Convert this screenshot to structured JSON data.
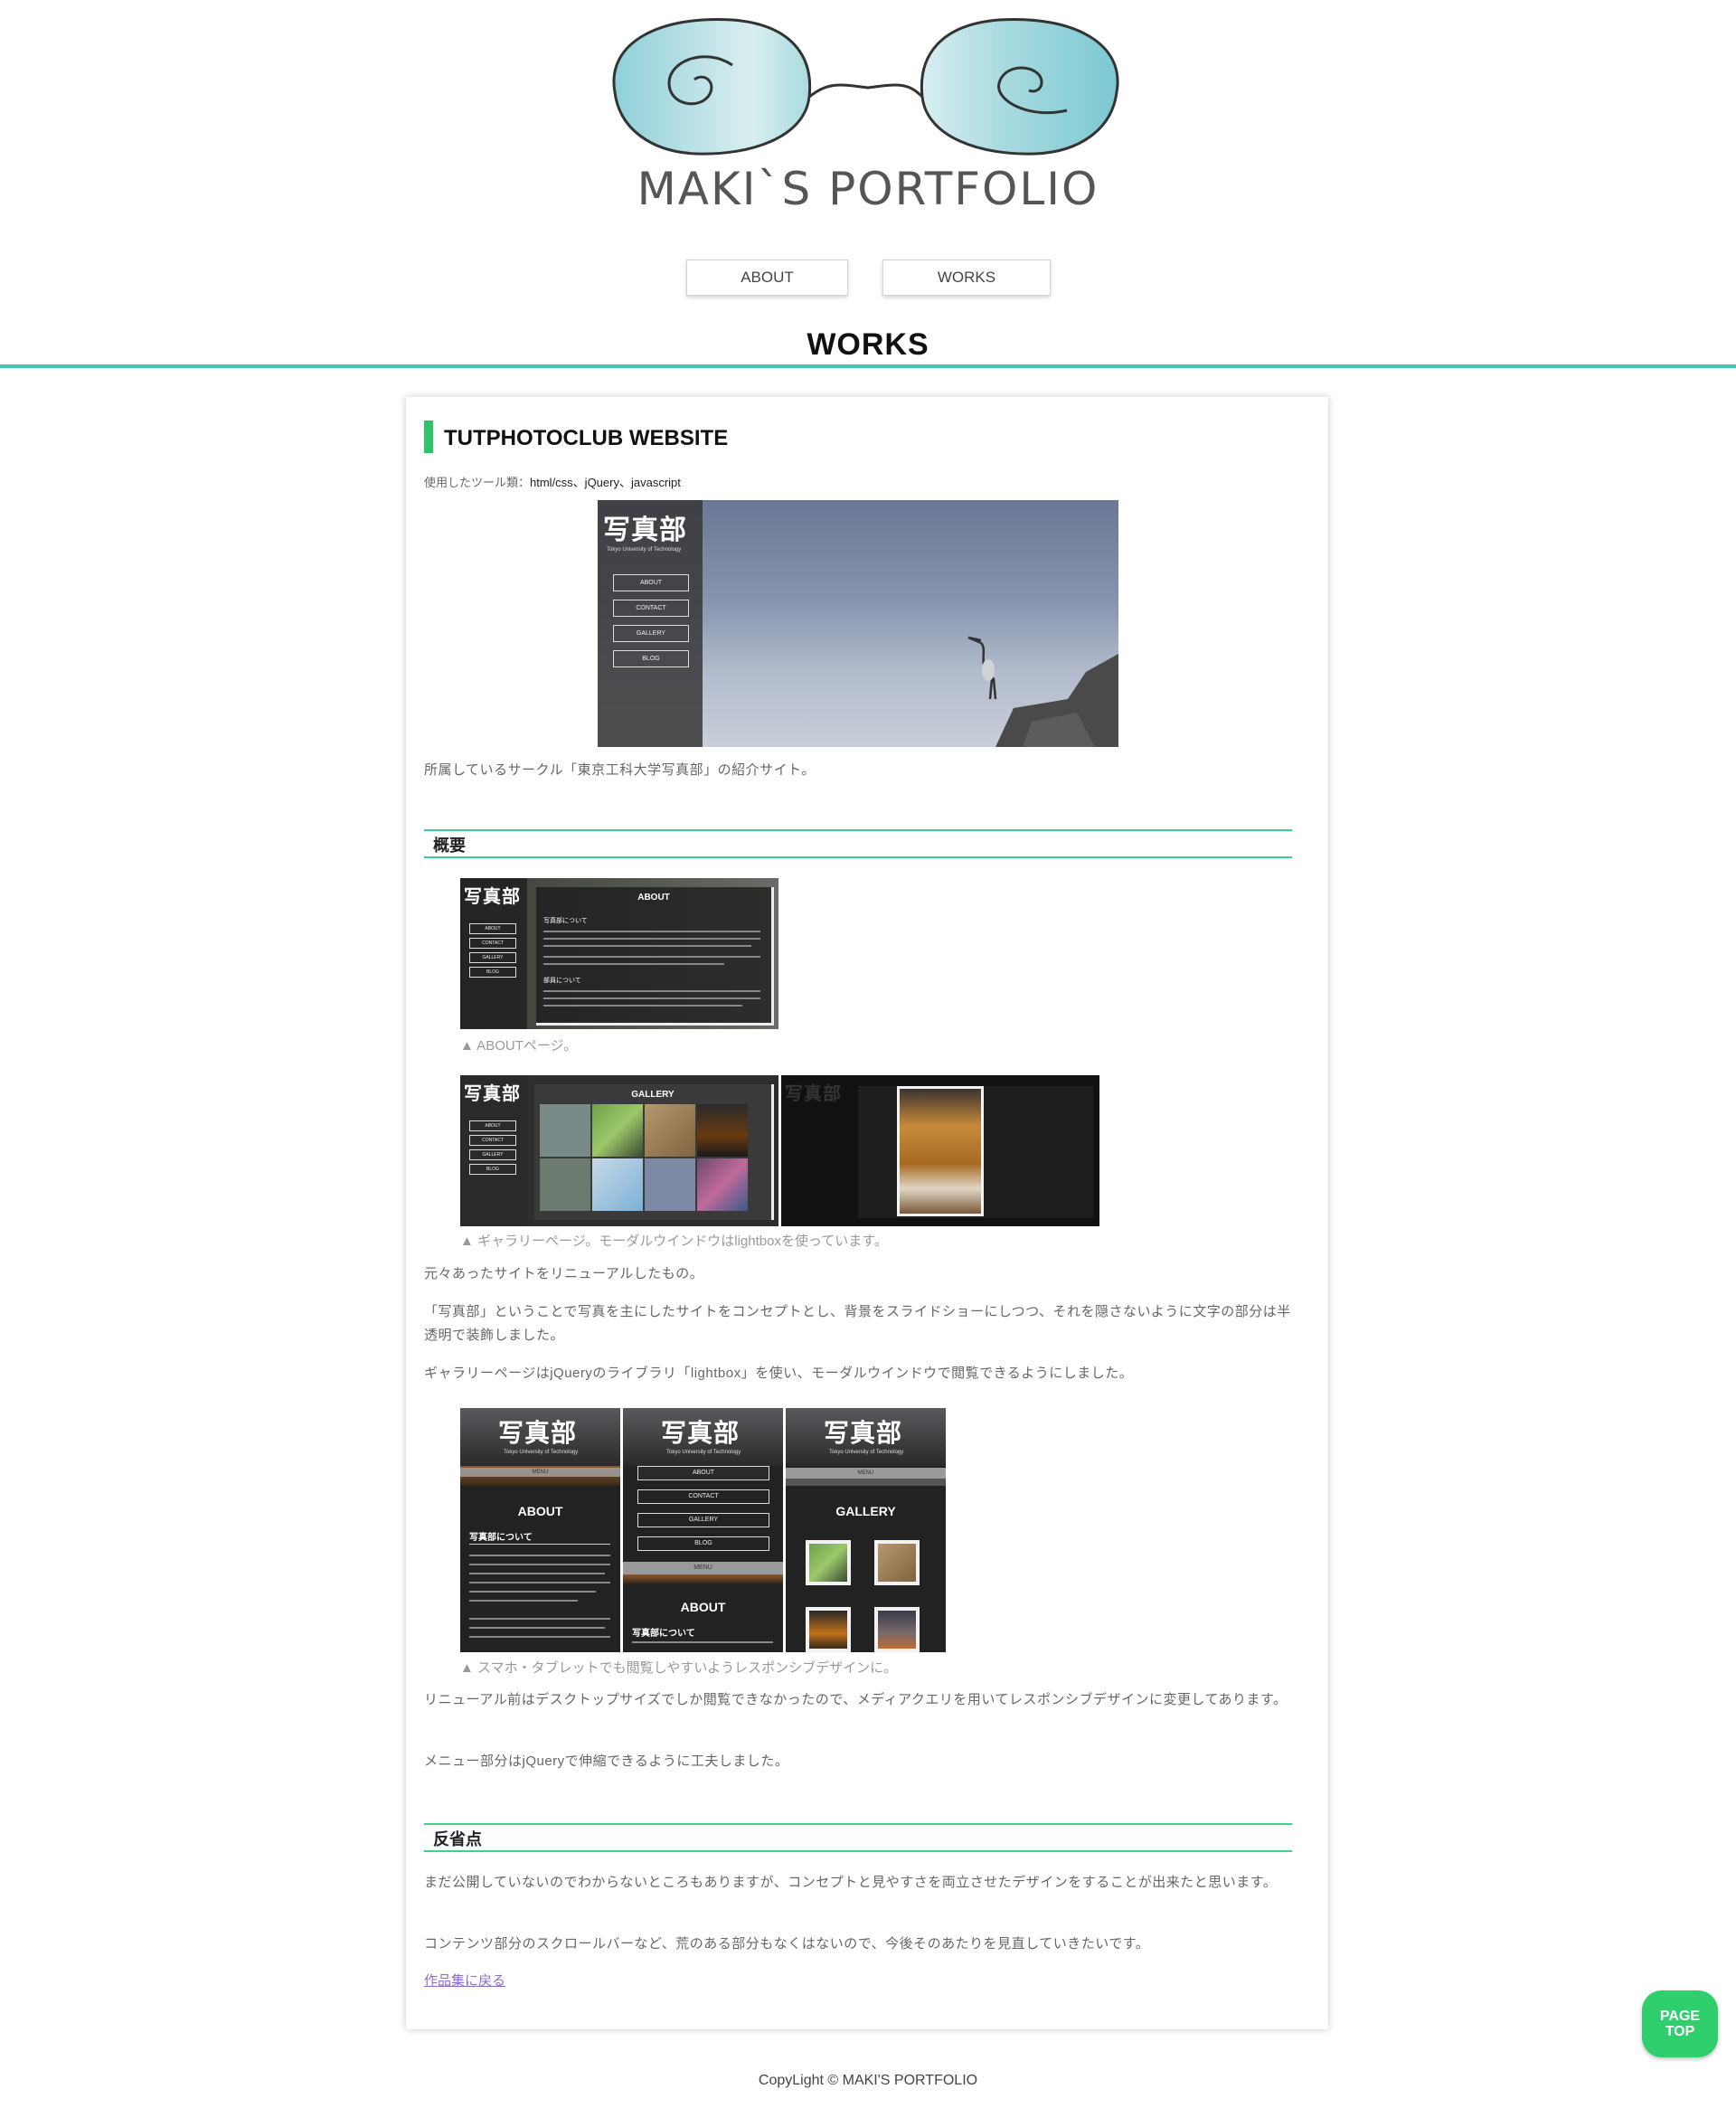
{
  "header": {
    "logo_text": "MAKI`S PORTFOLIO"
  },
  "nav": {
    "about": "ABOUT",
    "works": "WORKS"
  },
  "page": {
    "title": "WORKS"
  },
  "work": {
    "title": "TUTPHOTOCLUB WEBSITE",
    "tools_label": "使用したツール類：",
    "tools_value": "html/css、jQuery、javascript",
    "intro": "所属しているサークル「東京工科大学写真部」の紹介サイト。"
  },
  "screenshots": {
    "logo_kanji": "写真部",
    "logo_sub": "Tokyo University of Technology",
    "menu": [
      "ABOUT",
      "CONTACT",
      "GALLERY",
      "BLOG"
    ],
    "about_title": "ABOUT",
    "about_sub1": "写真部について",
    "about_sub2": "部員について",
    "gallery_title": "GALLERY",
    "mobile_menu": "MENU"
  },
  "overview": {
    "heading": "概要",
    "caption_about": "▲ ABOUTページ。",
    "caption_gallery": "▲ ギャラリーページ。モーダルウインドウはlightboxを使っています。",
    "para1": "元々あったサイトをリニューアルしたもの。",
    "para2": "「写真部」ということで写真を主にしたサイトをコンセプトとし、背景をスライドショーにしつつ、それを隠さないように文字の部分は半透明で装飾しました。",
    "para3": "ギャラリーページはjQueryのライブラリ「lightbox」を使い、モーダルウインドウで閲覧できるようにしました。",
    "caption_responsive": "▲ スマホ・タブレットでも閲覧しやすいようレスポンシブデザインに。",
    "para4": "リニューアル前はデスクトップサイズでしか閲覧できなかったので、メディアクエリを用いてレスポンシブデザインに変更してあります。",
    "para5": "メニュー部分はjQueryで伸縮できるように工夫しました。"
  },
  "reflection": {
    "heading": "反省点",
    "para1": "まだ公開していないのでわからないところもありますが、コンセプトと見やすさを両立させたデザインをすることが出来たと思います。",
    "para2": "コンテンツ部分のスクロールバーなど、荒のある部分もなくはないので、今後そのあたりを見直していきたいです。",
    "back_link": "作品集に戻る"
  },
  "pagetop": {
    "line1": "PAGE",
    "line2": "TOP"
  },
  "footer": {
    "text": "CopyLight © MAKI'S PORTFOLIO"
  },
  "colors": {
    "accent_teal": "#3fc7b4",
    "accent_green": "#2fc36a",
    "pagetop_green": "#2fcf6d",
    "link_purple": "#8e6cc9"
  }
}
